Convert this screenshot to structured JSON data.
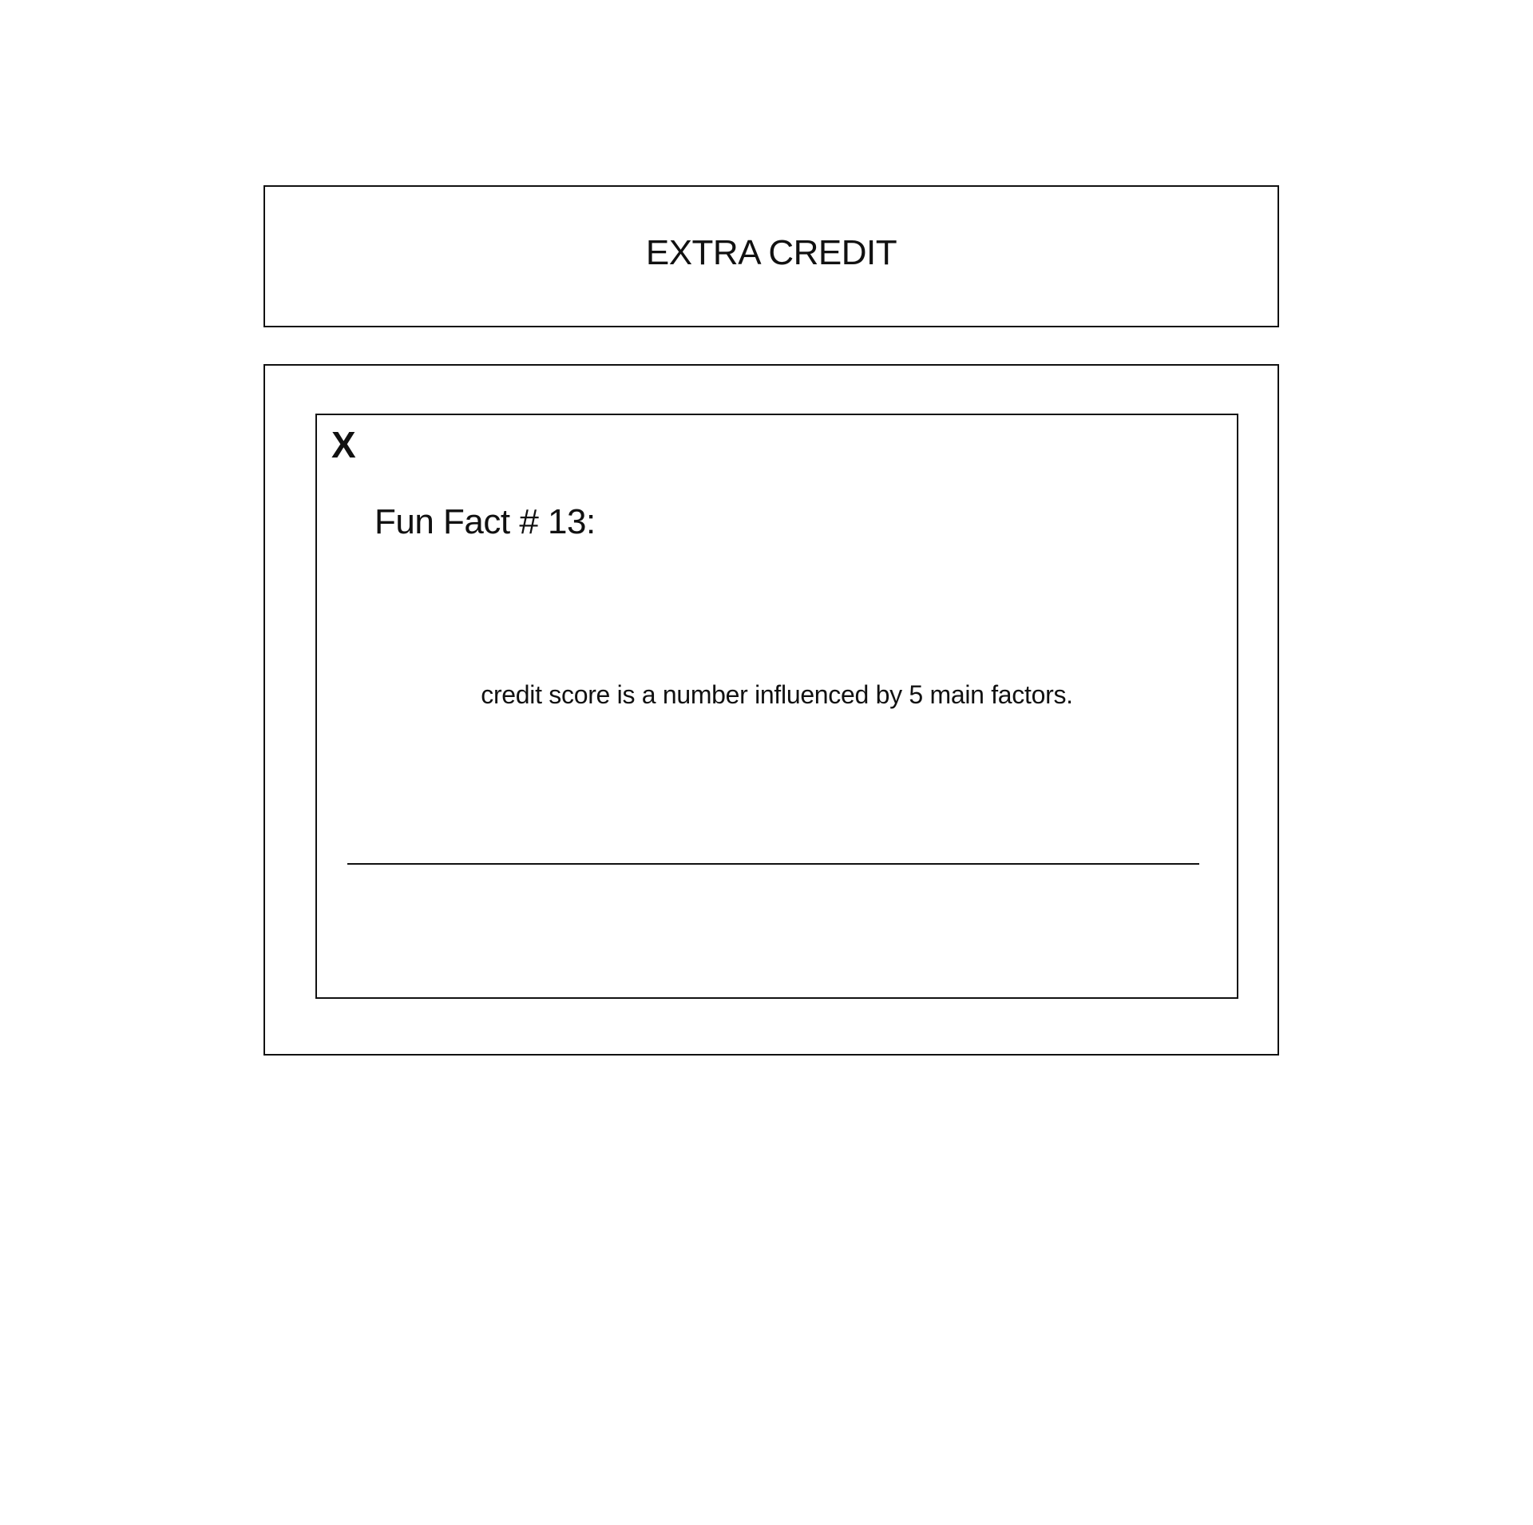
{
  "header": {
    "title": "EXTRA CREDIT"
  },
  "modal": {
    "close_label": "X",
    "fact_title": "Fun Fact # 13:",
    "fact_body": "credit score is a number influenced by 5 main factors."
  }
}
